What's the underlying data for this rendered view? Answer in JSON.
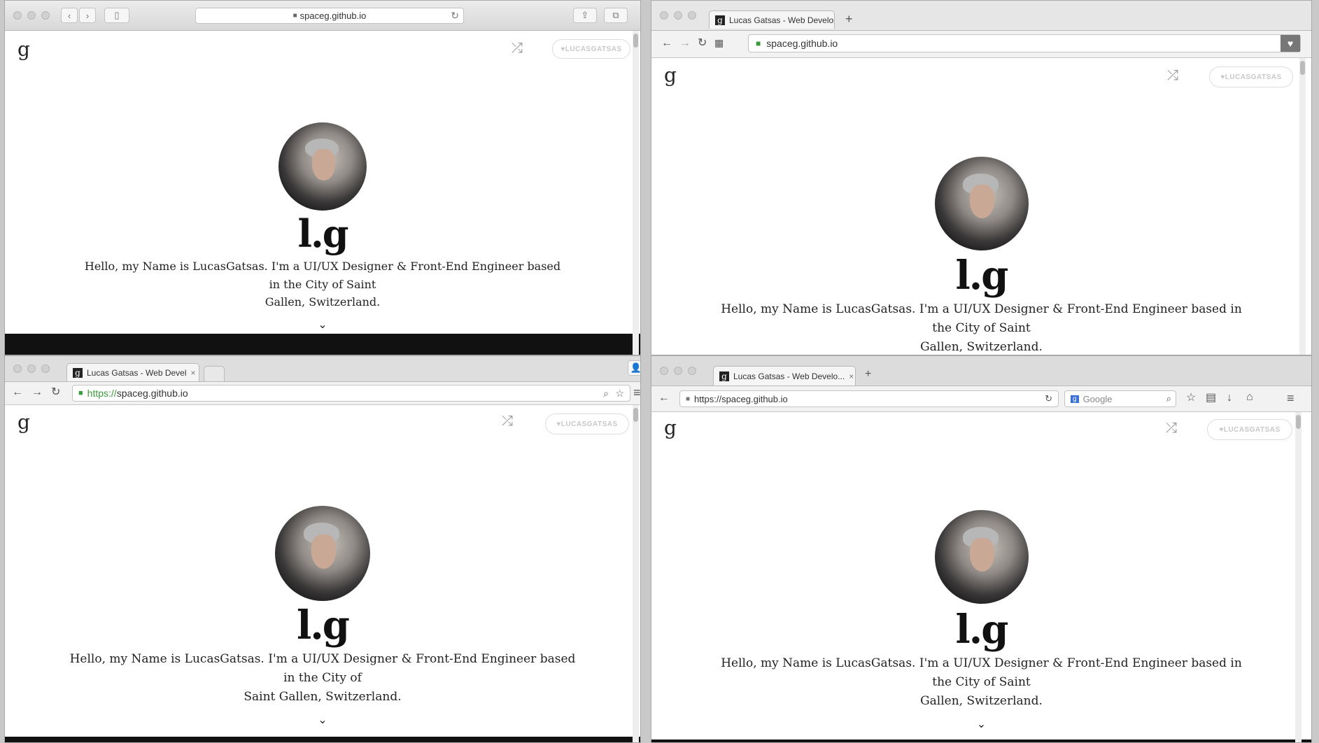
{
  "url_short": "spaceg.github.io",
  "url_full": "https://spaceg.github.io",
  "url_https_prefix": "https://",
  "tab_title_w2": "Lucas Gatsas - Web Develop",
  "tab_title_w3": "Lucas Gatsas - Web Devel",
  "tab_title_w4": "Lucas Gatsas - Web Develo...",
  "search_placeholder": "Google",
  "site": {
    "logo": "g",
    "twitter": "♥LUCASGATSAS",
    "monogram": "l.g",
    "bio_line1": "Hello, my Name is LucasGatsas. I'm a UI/UX Designer & Front-End Engineer based in the City of Saint",
    "bio_line2": "Gallen, Switzerland.",
    "bio_w3_line1": "Hello, my Name is LucasGatsas. I'm a UI/UX Designer & Front-End Engineer based in the City of",
    "bio_w3_line2": "Saint Gallen, Switzerland."
  },
  "icons": {
    "shuffle": "⤮",
    "chevron": "⌄",
    "reload": "↻",
    "back": "←",
    "forward": "→",
    "lock": "🔒",
    "star": "☆",
    "menu": "≡",
    "close": "×",
    "plus": "+",
    "heart": "♥",
    "home": "⌂",
    "download": "↓",
    "search": "⌕"
  }
}
